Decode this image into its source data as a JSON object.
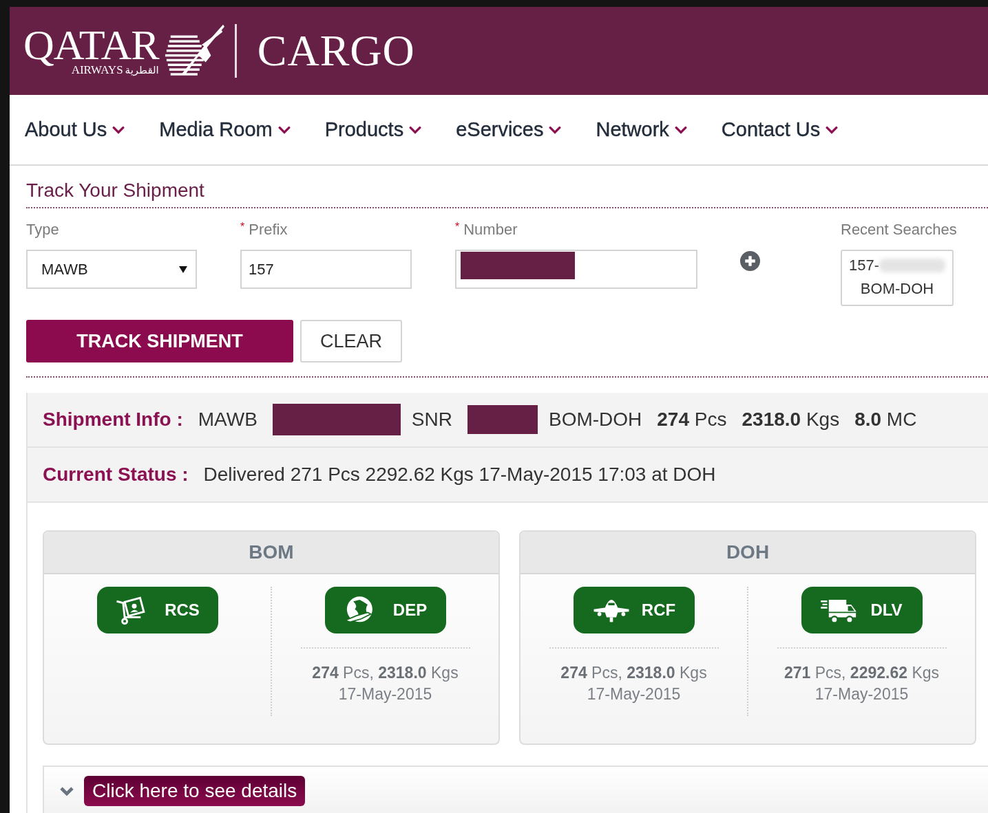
{
  "header": {
    "brand": "QATAR",
    "brand_sub": "AIRWAYS",
    "brand_arabic": "القطرية",
    "product": "CARGO"
  },
  "nav": [
    {
      "label": "About Us"
    },
    {
      "label": "Media Room"
    },
    {
      "label": "Products"
    },
    {
      "label": "eServices"
    },
    {
      "label": "Network"
    },
    {
      "label": "Contact Us"
    }
  ],
  "tracker": {
    "title": "Track Your Shipment",
    "type": {
      "label": "Type",
      "value": "MAWB"
    },
    "prefix": {
      "label": "Prefix",
      "required_mark": "*",
      "value": "157"
    },
    "number": {
      "label": "Number",
      "required_mark": "*",
      "redacted": true
    },
    "recent": {
      "label": "Recent Searches",
      "items": [
        {
          "number": "157-",
          "redacted": true,
          "route": "BOM-DOH"
        }
      ]
    },
    "buttons": [
      {
        "label": "TRACK SHIPMENT",
        "kind": "primary"
      },
      {
        "label": "CLEAR",
        "kind": "secondary"
      }
    ]
  },
  "shipment_info": {
    "label": "Shipment Info :",
    "parts": [
      {
        "kind": "text",
        "text": "MAWB"
      },
      {
        "kind": "redaction"
      },
      {
        "kind": "text",
        "text": "SNR"
      },
      {
        "kind": "shortredaction"
      },
      {
        "kind": "text",
        "text": "BOM-DOH"
      },
      {
        "kind": "text",
        "text": "**274** Pcs"
      },
      {
        "kind": "text",
        "text": "**2318.0** Kgs"
      },
      {
        "kind": "text",
        "text": "**8.0** MC"
      }
    ]
  },
  "current_status": {
    "label": "Current Status :",
    "text": "Delivered 271 Pcs 2292.62 Kgs 17-May-2015 17:03 at DOH"
  },
  "stations": [
    {
      "name": "BOM",
      "events": [
        {
          "code": "RCS",
          "kind": "received"
        },
        {
          "code": "DEP",
          "kind": "departed",
          "detail": "**274** Pcs, **2318.0** Kgs",
          "date": "17-May-2015"
        }
      ]
    },
    {
      "name": "DOH",
      "events": [
        {
          "code": "RCF",
          "kind": "arrived",
          "detail": "**274** Pcs, **2318.0** Kgs",
          "date": "17-May-2015"
        },
        {
          "code": "DLV",
          "kind": "delivered",
          "detail": "**271** Pcs, **2292.62** Kgs",
          "date": "17-May-2015"
        }
      ]
    }
  ],
  "details_link": {
    "label": "Click here to see details",
    "expanded": false
  }
}
